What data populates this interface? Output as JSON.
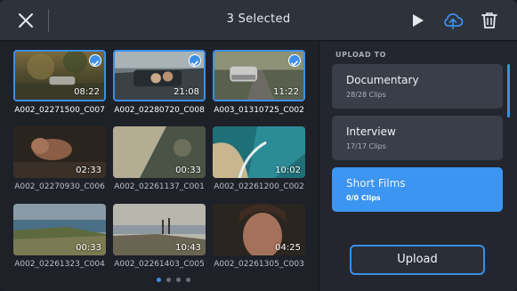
{
  "header": {
    "title": "3 Selected"
  },
  "clips": [
    {
      "name": "A002_02271500_C007",
      "duration": "08:22",
      "selected": true
    },
    {
      "name": "A002_02280720_C008",
      "duration": "21:08",
      "selected": true
    },
    {
      "name": "A003_01310725_C002",
      "duration": "11:22",
      "selected": true
    },
    {
      "name": "A002_02270930_C006",
      "duration": "02:33",
      "selected": false
    },
    {
      "name": "A002_02261137_C001",
      "duration": "00:33",
      "selected": false
    },
    {
      "name": "A002_02261200_C002",
      "duration": "10:02",
      "selected": false
    },
    {
      "name": "A002_02261323_C004",
      "duration": "00:33",
      "selected": false
    },
    {
      "name": "A002_02261403_C005",
      "duration": "10:43",
      "selected": false
    },
    {
      "name": "A002_02261305_C003",
      "duration": "04:25",
      "selected": false
    }
  ],
  "pager": {
    "pages": 4,
    "current": 1
  },
  "panel": {
    "heading": "UPLOAD TO",
    "destinations": [
      {
        "name": "Documentary",
        "count": "28/28 Clips",
        "active": false
      },
      {
        "name": "Interview",
        "count": "17/17 Clips",
        "active": false
      },
      {
        "name": "Short Films",
        "count": "0/0 Clips",
        "active": true
      }
    ],
    "upload_label": "Upload"
  },
  "colors": {
    "accent": "#3b8fe8",
    "header_bg": "#2e323b",
    "panel_bg": "#23262e",
    "card_bg": "#3a3e48",
    "active_card": "#3c95f0"
  },
  "icons": {
    "close": "close-icon",
    "play": "play-icon",
    "upload": "cloud-upload-icon",
    "delete": "trash-icon",
    "check": "checkmark-icon"
  }
}
